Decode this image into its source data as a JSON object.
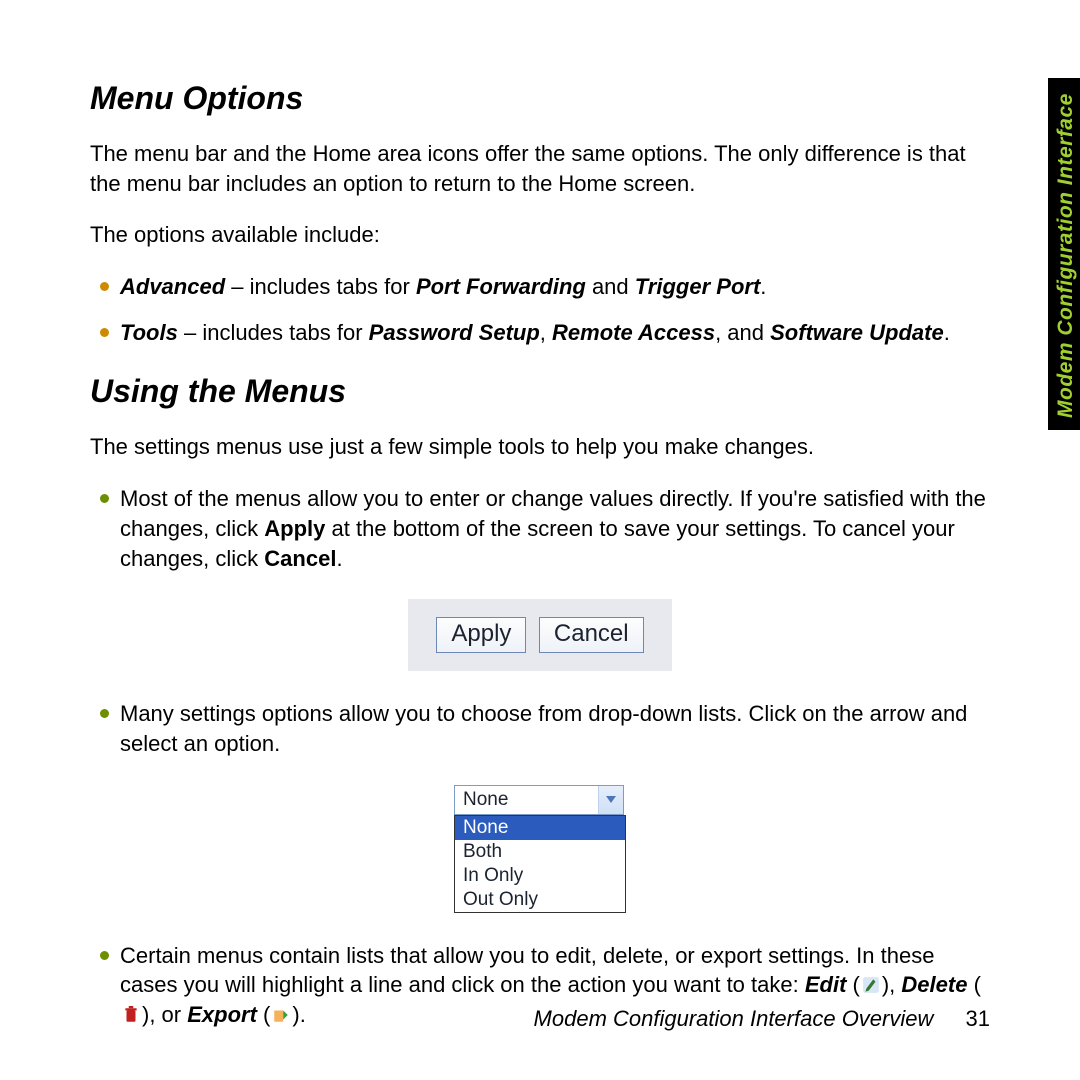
{
  "side_tab": "Modem Configuration Interface",
  "sections": {
    "menu_options": {
      "heading": "Menu Options",
      "intro": "The menu bar and the Home area icons offer the same options. The only difference is that the menu bar includes an option to return to the Home screen.",
      "lead": "The options available include:",
      "items": {
        "advanced": {
          "label": "Advanced",
          "dash": " – includes tabs for ",
          "t1": "Port Forwarding",
          "and": " and ",
          "t2": "Trigger Port",
          "period": "."
        },
        "tools": {
          "label": "Tools",
          "dash": " – includes tabs for ",
          "t1": "Password Setup",
          "c1": ", ",
          "t2": "Remote Access",
          "c2": ", and ",
          "t3": "Software Update",
          "period": "."
        }
      }
    },
    "using_menus": {
      "heading": "Using the Menus",
      "intro": "The settings menus use just a few simple tools to help you make changes.",
      "b1": {
        "pre": "Most of the menus allow you to enter or change values directly. If you're satisfied with the changes, click ",
        "apply": "Apply",
        "mid": " at the bottom of the screen to save your settings. To cancel your changes, click ",
        "cancel": "Cancel",
        "period": "."
      },
      "buttons": {
        "apply": "Apply",
        "cancel": "Cancel"
      },
      "b2": "Many settings options allow you to choose from drop-down lists. Click on the arrow and select an option.",
      "dropdown": {
        "selected": "None",
        "options": [
          "None",
          "Both",
          "In Only",
          "Out Only"
        ]
      },
      "b3": {
        "pre": "Certain menus contain lists that allow you to edit, delete, or export settings. In these cases you will highlight a line and click on the action you want to take: ",
        "edit": "Edit",
        "c1": " (",
        "c2": "), ",
        "del": "Delete",
        "c3": " (",
        "c4": "), or ",
        "exp": "Export",
        "c5": " (",
        "c6": ")."
      }
    }
  },
  "footer": {
    "title": "Modem Configuration Interface Overview",
    "page": "31"
  }
}
